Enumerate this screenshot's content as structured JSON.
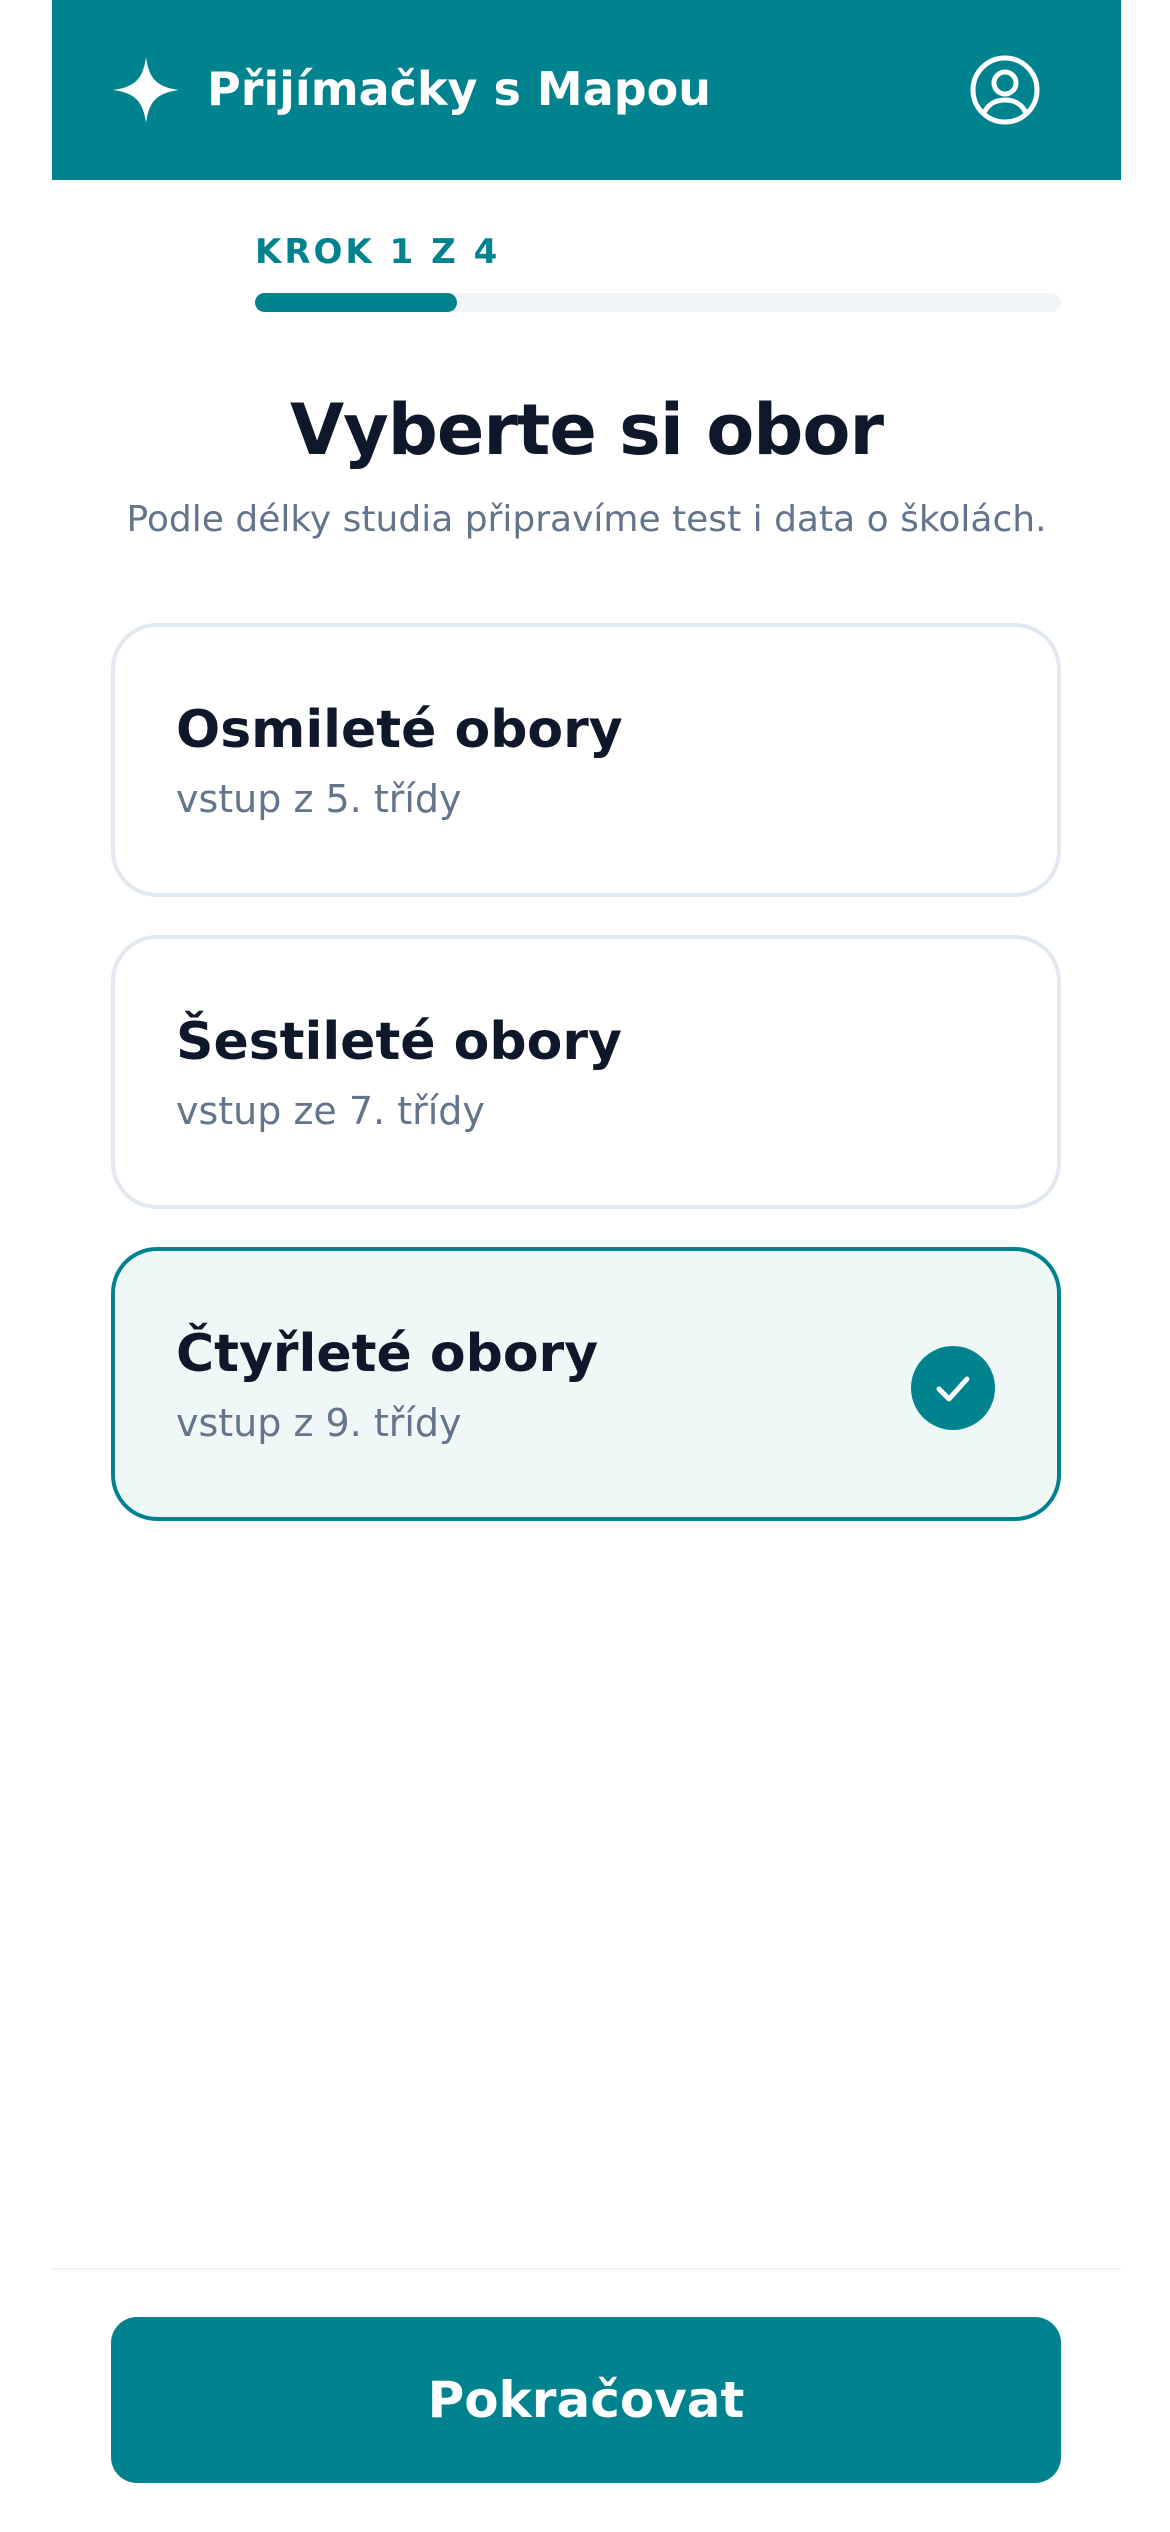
{
  "header": {
    "title": "Přijímačky s Mapou",
    "logo_icon": "sparkle-icon",
    "profile_icon": "user-circle-icon"
  },
  "step": {
    "label": "KROK 1 Z 4",
    "current": 1,
    "total": 4,
    "progress": 0.25
  },
  "page": {
    "title": "Vyberte si obor",
    "subtitle": "Podle délky studia připravíme test i data o školách."
  },
  "options": [
    {
      "title": "Osmileté obory",
      "subtitle": "vstup z 5. třídy",
      "selected": false
    },
    {
      "title": "Šestileté obory",
      "subtitle": "vstup ze 7. třídy",
      "selected": false
    },
    {
      "title": "Čtyřleté obory",
      "subtitle": "vstup z 9. třídy",
      "selected": true
    }
  ],
  "footer": {
    "continue_label": "Pokračovat"
  },
  "colors": {
    "accent": "#00838f",
    "selected_background": "#f0f8f7",
    "card_border": "#e2e8f0",
    "heading": "#0f172a",
    "muted_text": "#64748b",
    "track": "#f1f5f9"
  }
}
